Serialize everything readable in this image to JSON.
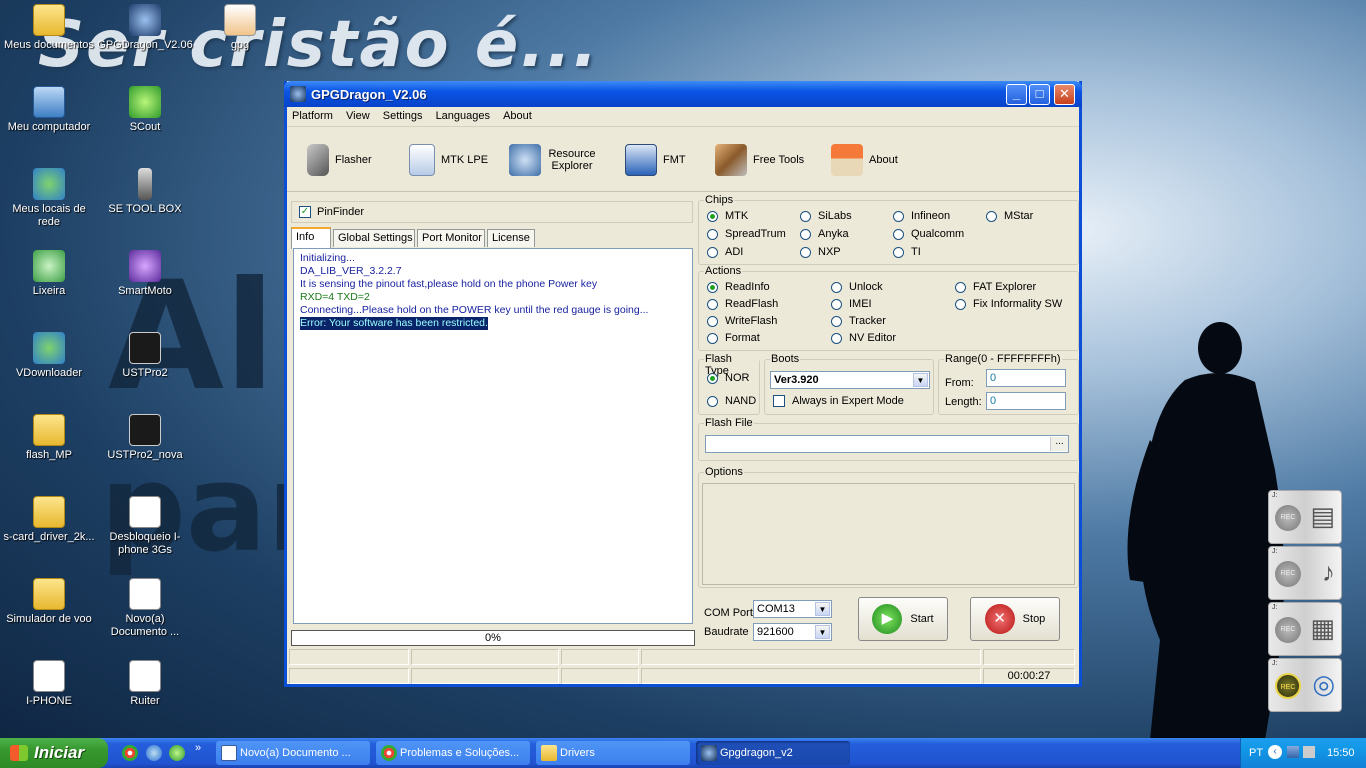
{
  "wallpaper": {
    "line1": "Ser cristão é...",
    "line2": "Al",
    "line3": "par"
  },
  "desktop_icons": [
    {
      "label": "Meus documentos",
      "kind": "folder"
    },
    {
      "label": "GPGDragon_V2.06",
      "kind": "dragon"
    },
    {
      "label": "gpg",
      "kind": "gpg"
    },
    {
      "label": "Meu computador",
      "kind": "pc"
    },
    {
      "label": "SCout",
      "kind": "green"
    },
    {
      "label": "Meus locais de rede",
      "kind": "globe"
    },
    {
      "label": "SE TOOL BOX",
      "kind": "phone"
    },
    {
      "label": "Lixeira",
      "kind": "recycle"
    },
    {
      "label": "SmartMoto",
      "kind": "purple"
    },
    {
      "label": "VDownloader",
      "kind": "globe"
    },
    {
      "label": "USTPro2",
      "kind": "dark"
    },
    {
      "label": "flash_MP",
      "kind": "folder"
    },
    {
      "label": "USTPro2_nova",
      "kind": "dark"
    },
    {
      "label": "s-card_driver_2k...",
      "kind": "folder"
    },
    {
      "label": "Desbloqueio I-phone 3Gs",
      "kind": "doc"
    },
    {
      "label": "Simulador de voo",
      "kind": "folder"
    },
    {
      "label": "Novo(a) Documento ...",
      "kind": "doc"
    },
    {
      "label": "I-PHONE",
      "kind": "doc"
    },
    {
      "label": "Ruiter",
      "kind": "doc"
    }
  ],
  "widget": {
    "drive_label": "J:",
    "rec_label": "REC"
  },
  "window": {
    "title": "GPGDragon_V2.06",
    "menu": [
      "Platform",
      "View",
      "Settings",
      "Languages",
      "About"
    ],
    "toolbar": [
      {
        "label": "Flasher",
        "icon": "phone-icon"
      },
      {
        "label": "MTK LPE",
        "icon": "document-icon"
      },
      {
        "label": "Resource Explorer",
        "icon": "resource-icon"
      },
      {
        "label": "FMT",
        "icon": "monitor-icon"
      },
      {
        "label": "Free Tools",
        "icon": "tools-icon"
      },
      {
        "label": "About",
        "icon": "house-icon"
      }
    ],
    "pinfinder": {
      "label": "PinFinder",
      "checked": true
    },
    "tabs": [
      "Info",
      "Global Settings",
      "Port Monitor",
      "License"
    ],
    "log": [
      {
        "text": "Initializing...",
        "style": "blue"
      },
      {
        "text": "DA_LIB_VER_3.2.2.7",
        "style": "blue"
      },
      {
        "text": "It is sensing the pinout fast,please hold on the phone Power key",
        "style": "blue"
      },
      {
        "text": "RXD=4  TXD=2",
        "style": "green"
      },
      {
        "text": "Connecting...Please hold on the POWER key until the red gauge is going...",
        "style": "blue"
      },
      {
        "text": "Error: Your software has been restricted.",
        "style": "err"
      }
    ],
    "progress": "0%",
    "chips": {
      "label": "Chips",
      "options": [
        "MTK",
        "SiLabs",
        "Infineon",
        "MStar",
        "SpreadTrum",
        "Anyka",
        "Qualcomm",
        "ADI",
        "NXP",
        "TI"
      ],
      "selected": "MTK"
    },
    "actions": {
      "label": "Actions",
      "options": [
        "ReadInfo",
        "Unlock",
        "FAT Explorer",
        "ReadFlash",
        "IMEI",
        "Fix Informality SW",
        "WriteFlash",
        "Tracker",
        "Format",
        "NV Editor"
      ],
      "selected": "ReadInfo"
    },
    "flash_type": {
      "label": "Flash Type",
      "options": [
        "NOR",
        "NAND"
      ],
      "selected": "NOR"
    },
    "boots": {
      "label": "Boots",
      "value": "Ver3.920",
      "expert_label": "Always in Expert Mode"
    },
    "range": {
      "label": "Range(0 - FFFFFFFFh)",
      "from_label": "From:",
      "from_value": "0",
      "length_label": "Length:",
      "length_value": "0"
    },
    "flash_file": {
      "label": "Flash File",
      "value": "",
      "browse": "..."
    },
    "options": {
      "label": "Options"
    },
    "com": {
      "port_label": "COM Port",
      "port_value": "COM13",
      "baud_label": "Baudrate",
      "baud_value": "921600"
    },
    "start_label": "Start",
    "stop_label": "Stop",
    "status_time": "00:00:27"
  },
  "taskbar": {
    "start": "Iniciar",
    "tasks": [
      {
        "label": "Novo(a) Documento ...",
        "active": false
      },
      {
        "label": "Problemas e Soluções...",
        "active": false
      },
      {
        "label": "Drivers",
        "active": false
      },
      {
        "label": "Gpgdragon_v2",
        "active": true
      }
    ],
    "lang": "PT",
    "clock": "15:50"
  }
}
